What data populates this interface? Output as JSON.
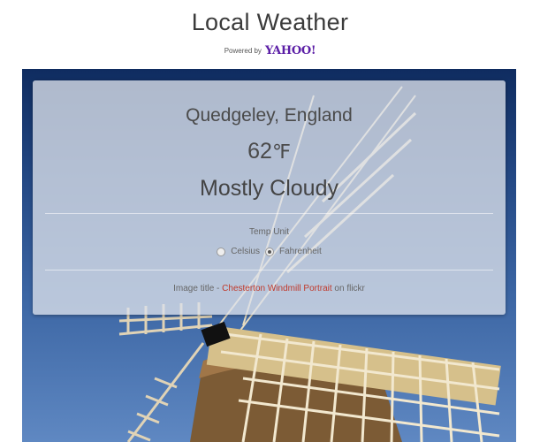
{
  "header": {
    "title": "Local Weather",
    "powered_by": "Powered by",
    "brand": "YAHOO!"
  },
  "weather": {
    "location": "Quedgeley, England",
    "temperature": "62",
    "unit": "℉",
    "condition": "Mostly Cloudy"
  },
  "units": {
    "label": "Temp Unit",
    "options": [
      "Celsius",
      "Fahrenheit"
    ],
    "selected": "Fahrenheit"
  },
  "credit": {
    "prefix": "Image title -",
    "link_text": "Chesterton Windmill Portrait",
    "suffix": "on flickr"
  },
  "colors": {
    "brand": "#5b1ea6",
    "link": "#c0392b",
    "sky": "#244985"
  }
}
